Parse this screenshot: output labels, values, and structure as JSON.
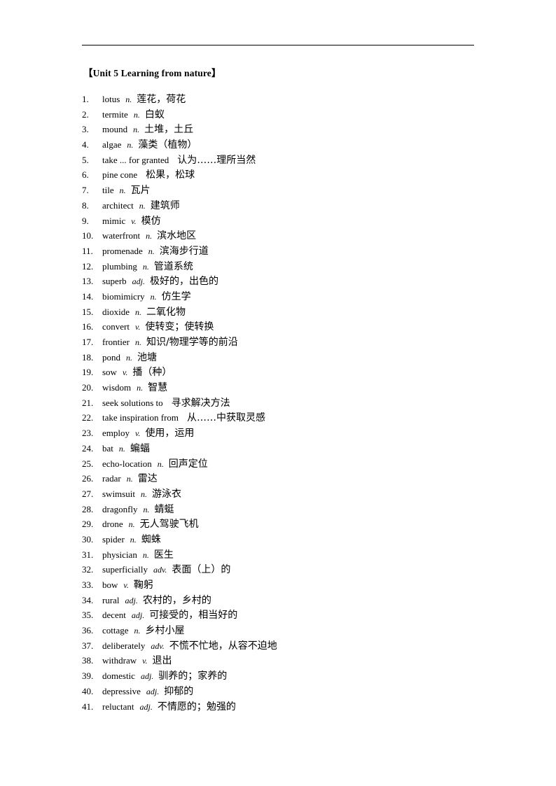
{
  "document": {
    "title": "【Unit 5 Learning from nature】",
    "has_header_rule": true
  },
  "vocab": {
    "entries": [
      {
        "num": "1.",
        "word": "lotus",
        "pos": "n.",
        "def": "莲花，荷花"
      },
      {
        "num": "2.",
        "word": "termite",
        "pos": "n.",
        "def": "白蚁"
      },
      {
        "num": "3.",
        "word": "mound",
        "pos": "n.",
        "def": "土堆，土丘"
      },
      {
        "num": "4.",
        "word": "algae",
        "pos": "n.",
        "def": "藻类（植物）"
      },
      {
        "num": "5.",
        "word": "take ... for granted",
        "pos": "",
        "def": "认为……理所当然"
      },
      {
        "num": "6.",
        "word": "pine cone",
        "pos": "",
        "def": "松果，松球"
      },
      {
        "num": "7.",
        "word": "tile",
        "pos": "n.",
        "def": "瓦片"
      },
      {
        "num": "8.",
        "word": "architect",
        "pos": "n.",
        "def": "建筑师"
      },
      {
        "num": "9.",
        "word": "mimic",
        "pos": "v.",
        "def": "模仿"
      },
      {
        "num": "10.",
        "word": "waterfront",
        "pos": "n.",
        "def": "滨水地区"
      },
      {
        "num": "11.",
        "word": "promenade",
        "pos": "n.",
        "def": "滨海步行道"
      },
      {
        "num": "12.",
        "word": "plumbing",
        "pos": "n.",
        "def": "管道系统"
      },
      {
        "num": "13.",
        "word": "superb",
        "pos": "adj.",
        "def": "极好的，出色的"
      },
      {
        "num": "14.",
        "word": "biomimicry",
        "pos": "n.",
        "def": "仿生学"
      },
      {
        "num": "15.",
        "word": "dioxide",
        "pos": "n.",
        "def": "二氧化物"
      },
      {
        "num": "16.",
        "word": "convert",
        "pos": "v.",
        "def": "使转变；使转换"
      },
      {
        "num": "17.",
        "word": "frontier",
        "pos": "n.",
        "def": "知识/物理学等的前沿"
      },
      {
        "num": "18.",
        "word": "pond",
        "pos": "n.",
        "def": "池塘"
      },
      {
        "num": "19.",
        "word": "sow",
        "pos": "v.",
        "def": "播（种）"
      },
      {
        "num": "20.",
        "word": "wisdom",
        "pos": "n.",
        "def": "智慧"
      },
      {
        "num": "21.",
        "word": "seek solutions to",
        "pos": "",
        "def": "寻求解决方法"
      },
      {
        "num": "22.",
        "word": "take inspiration from",
        "pos": "",
        "def": "从……中获取灵感"
      },
      {
        "num": "23.",
        "word": "employ",
        "pos": "v.",
        "def": "使用，运用"
      },
      {
        "num": "24.",
        "word": "bat",
        "pos": "n.",
        "def": "蝙蝠"
      },
      {
        "num": "25.",
        "word": "echo-location",
        "pos": "n.",
        "def": "回声定位"
      },
      {
        "num": "26.",
        "word": "radar",
        "pos": "n.",
        "def": "雷达"
      },
      {
        "num": "27.",
        "word": "swimsuit",
        "pos": "n.",
        "def": "游泳衣"
      },
      {
        "num": "28.",
        "word": "dragonfly",
        "pos": "n.",
        "def": "蜻蜓"
      },
      {
        "num": "29.",
        "word": "drone",
        "pos": "n.",
        "def": "无人驾驶飞机"
      },
      {
        "num": "30.",
        "word": "spider",
        "pos": "n.",
        "def": "蜘蛛"
      },
      {
        "num": "31.",
        "word": "physician",
        "pos": "n.",
        "def": "医生"
      },
      {
        "num": "32.",
        "word": "superficially",
        "pos": "adv.",
        "def": "表面（上）的"
      },
      {
        "num": "33.",
        "word": "bow",
        "pos": "v.",
        "def": "鞠躬"
      },
      {
        "num": "34.",
        "word": "rural",
        "pos": "adj.",
        "def": "农村的，乡村的"
      },
      {
        "num": "35.",
        "word": "decent",
        "pos": "adj.",
        "def": "可接受的，相当好的"
      },
      {
        "num": "36.",
        "word": "cottage",
        "pos": "n.",
        "def": "乡村小屋"
      },
      {
        "num": "37.",
        "word": "deliberately",
        "pos": "adv.",
        "def": "不慌不忙地，从容不迫地"
      },
      {
        "num": "38.",
        "word": "withdraw",
        "pos": "v.",
        "def": "退出"
      },
      {
        "num": "39.",
        "word": "domestic",
        "pos": "adj.",
        "def": "驯养的；家养的"
      },
      {
        "num": "40.",
        "word": "depressive",
        "pos": "adj.",
        "def": "抑郁的"
      },
      {
        "num": "41.",
        "word": "reluctant",
        "pos": "adj.",
        "def": "不情愿的；勉强的"
      }
    ]
  }
}
